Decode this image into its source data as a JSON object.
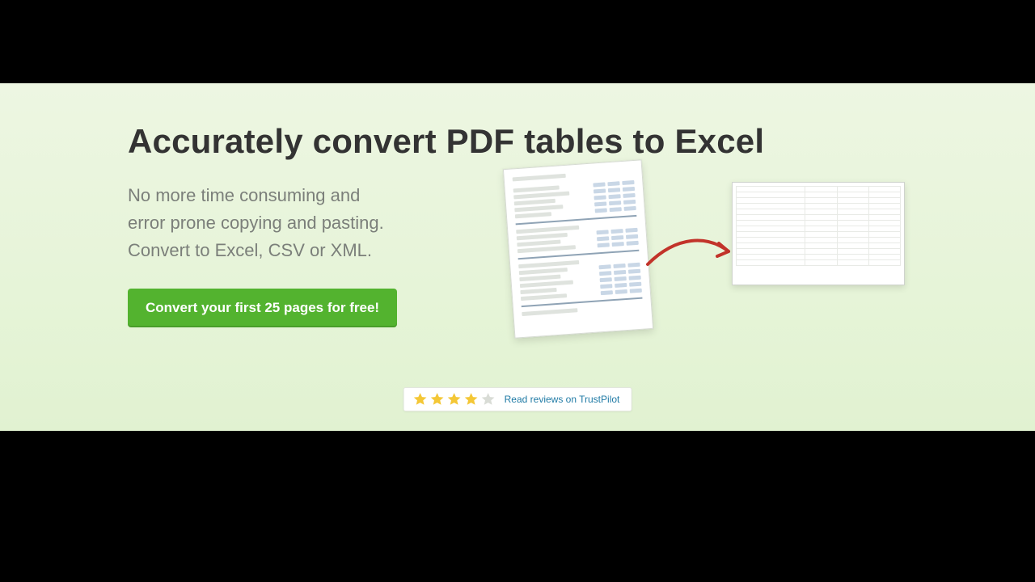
{
  "hero": {
    "headline": "Accurately convert PDF tables to Excel",
    "sub_l1": "No more time consuming and",
    "sub_l2": "error prone copying and pasting.",
    "sub_l3": "Convert to Excel, CSV or XML.",
    "cta_label": "Convert your first 25 pages for free!"
  },
  "reviews": {
    "rating_full": 4,
    "rating_empty": 1,
    "link_text": "Read reviews on TrustPilot"
  },
  "colors": {
    "cta_bg": "#53b32f",
    "star_fill": "#f4c736",
    "star_empty": "#d9dcd6",
    "arrow": "#c2332a"
  }
}
